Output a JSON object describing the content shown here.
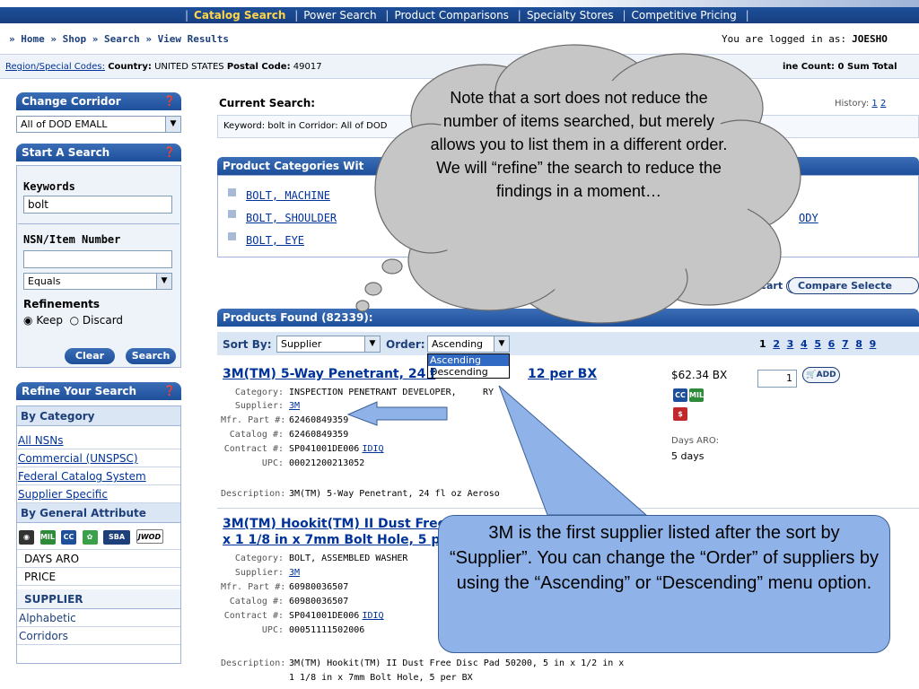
{
  "topnav": {
    "items": [
      "Catalog Search",
      "Power Search",
      "Product Comparisons",
      "Specialty Stores",
      "Competitive Pricing"
    ],
    "active": "Catalog Search"
  },
  "breadcrumb": {
    "text": "» Home » Shop » Search » View Results",
    "login_label": "You are logged in as:",
    "login_user": "JOESHO"
  },
  "region": {
    "link": "Region/Special Codes:",
    "country_label": "Country:",
    "country": "UNITED STATES",
    "postal_label": "Postal Code:",
    "postal": "49017",
    "right_text": "ine Count: 0 Sum Total"
  },
  "sidebar": {
    "change_corridor": {
      "title": "Change Corridor",
      "value": "All of DOD EMALL"
    },
    "start_search": {
      "title": "Start A Search",
      "keywords_label": "Keywords",
      "keywords_value": "bolt",
      "nsn_label": "NSN/Item Number",
      "nsn_value": "",
      "match_value": "Equals",
      "refinements_label": "Refinements",
      "keep_label": "Keep",
      "discard_label": "Discard",
      "clear_label": "Clear",
      "search_label": "Search"
    },
    "refine": {
      "title": "Refine Your Search",
      "by_category": "By Category",
      "category_links": [
        "All NSNs",
        "Commercial (UNSPSC)",
        "Federal Catalog System",
        "Supplier Specific"
      ],
      "by_attribute": "By General Attribute",
      "attr_icons": [
        "camera-icon",
        "mil-icon",
        "cc-icon",
        "green-icon",
        "sba-icon",
        "jwod-icon"
      ],
      "attr_icon_labels": [
        "",
        "MIL",
        "CC",
        "",
        "SBA",
        "JWOD"
      ],
      "attr_links": [
        "DAYS ARO",
        "PRICE"
      ],
      "supplier_head": "SUPPLIER",
      "supplier_links": [
        "Alphabetic",
        "Corridors"
      ]
    }
  },
  "main": {
    "current_search_label": "Current Search:",
    "keyword_line": "Keyword: bolt in Corridor: All of DOD",
    "history_label": "History:",
    "history_links": [
      "1",
      "2"
    ],
    "categories_head": "Product Categories Wit",
    "categories": [
      "BOLT, MACHINE",
      "BOLT, SHOULDER",
      "BOLT, EYE"
    ],
    "categories_right": "ODY",
    "add_cart_label": "d Selected to Cart",
    "compare_label": "Compare Selecte",
    "products_found": "Products Found (82339):",
    "sort_by_label": "Sort By:",
    "sort_by_value": "Supplier",
    "order_label": "Order:",
    "order_value": "Ascending",
    "order_options": [
      "Ascending",
      "Descending"
    ],
    "pages": [
      "1",
      "2",
      "3",
      "4",
      "5",
      "6",
      "7",
      "8",
      "9"
    ]
  },
  "products": [
    {
      "title": "3M(TM) 5-Way Penetrant, 24 f",
      "title_tail": "12 per BX",
      "category": "INSPECTION PENETRANT DEVELOPER,",
      "category_tail": "RY",
      "supplier": "3M",
      "mfr_part": "62460849359",
      "catalog": "62460849359",
      "contract": "SP041001DE006",
      "contract_link": "IDIQ",
      "upc": "00021200213052",
      "description": "3M(TM) 5-Way Penetrant, 24 fl oz Aeroso",
      "price": "$62.34 BX",
      "qty": "1",
      "add_label": "ADD",
      "days_aro_label": "Days ARO:",
      "days_aro": "5 days"
    },
    {
      "title_line1": "3M(TM) Hookit(TM) II Dust Free",
      "title_line2": "x 1 1/8 in x 7mm Bolt Hole, 5 pe",
      "category": "BOLT, ASSEMBLED WASHER",
      "supplier": "3M",
      "mfr_part": "60980036507",
      "catalog": "60980036507",
      "contract": "SP041001DE006",
      "contract_link": "IDIQ",
      "upc": "00051111502006",
      "description_line1": "3M(TM) Hookit(TM) II Dust Free Disc Pad 50200, 5 in x 1/2 in x",
      "description_line2": "1 1/8 in x 7mm Bolt Hole, 5 per BX"
    }
  ],
  "labels": {
    "category": "Category:",
    "supplier": "Supplier:",
    "mfr_part": "Mfr. Part #:",
    "catalog": "Catalog #:",
    "contract": "Contract #:",
    "upc": "UPC:",
    "description": "Description:"
  },
  "callouts": {
    "cloud": "Note that a sort does not reduce the number of items searched, but merely allows you to list them in a different order. We will “refine” the search to reduce the findings in a moment…",
    "bubble": "3M is the first supplier listed after the sort by “Supplier”.  You can change the “Order” of suppliers by using the “Ascending” or “Descending” menu option."
  },
  "colors": {
    "nav": "#1d4f9a",
    "link": "#003399",
    "callout_blue": "#8fb3e8",
    "cloud_gray": "#c6c6c6"
  }
}
